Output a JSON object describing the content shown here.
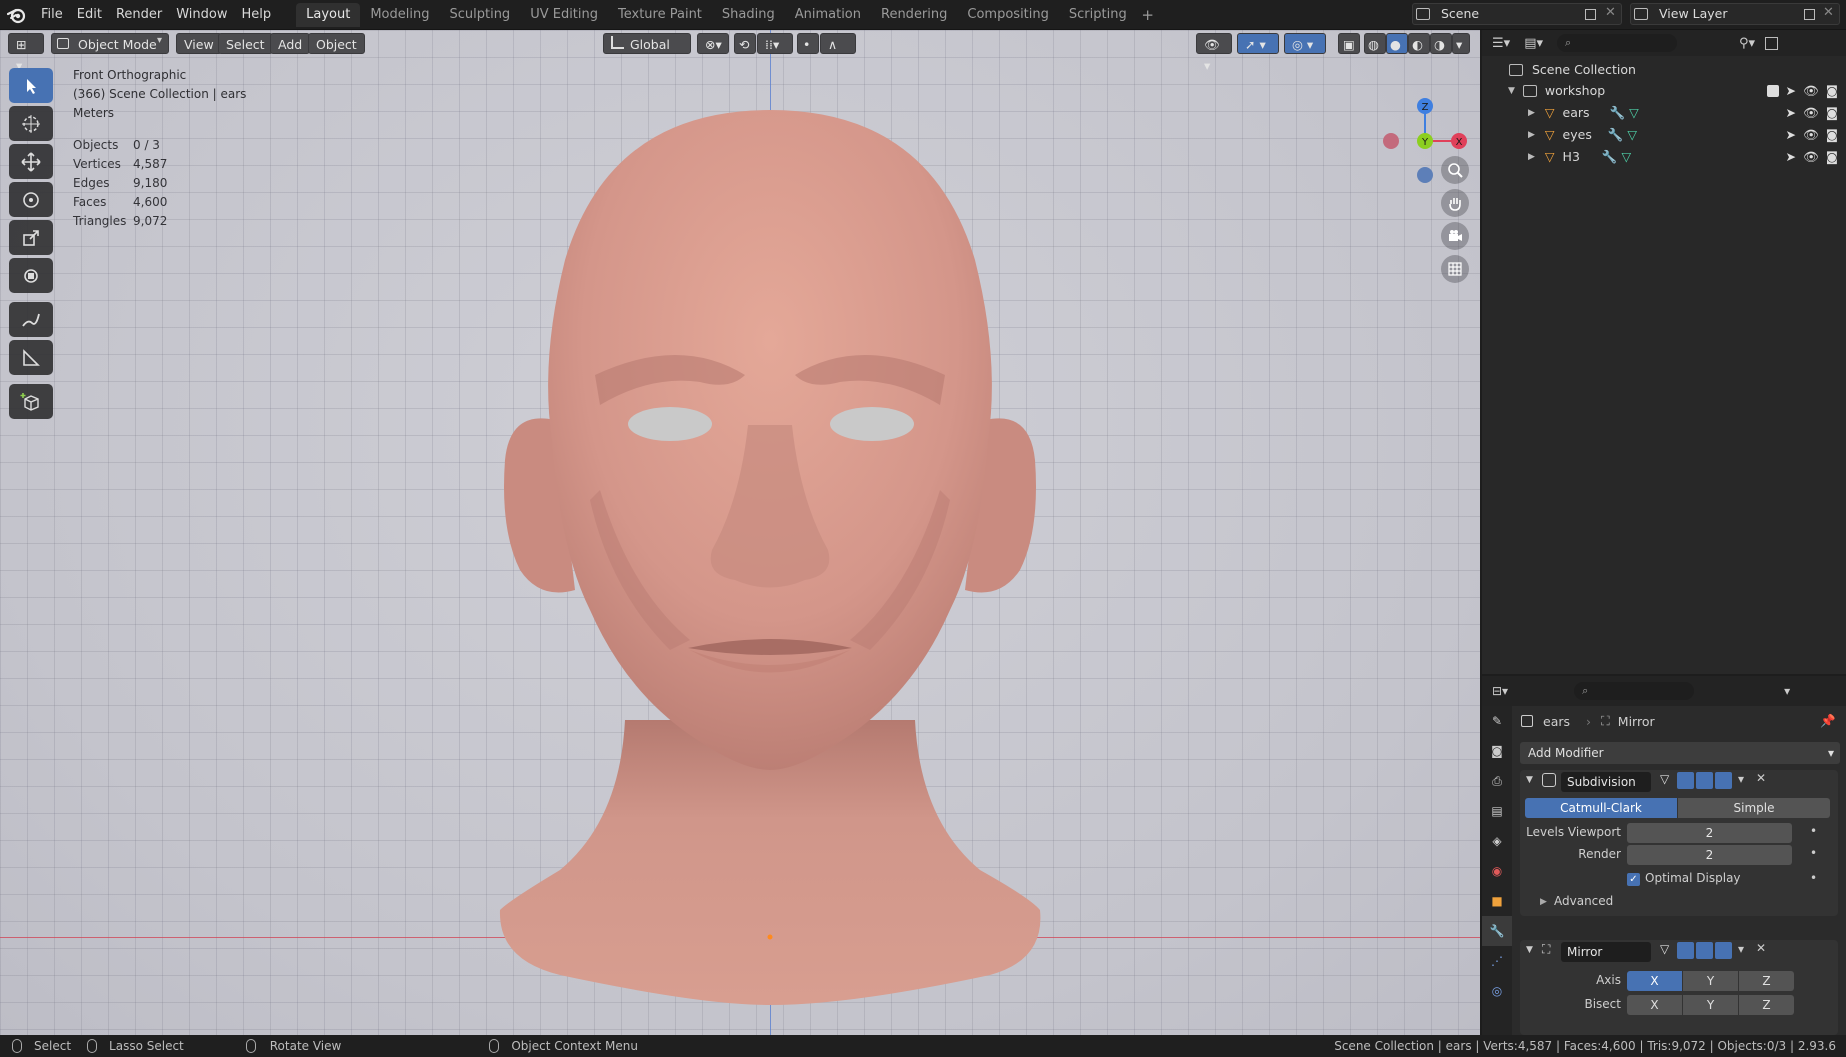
{
  "menu": [
    "File",
    "Edit",
    "Render",
    "Window",
    "Help"
  ],
  "workspaces": [
    "Layout",
    "Modeling",
    "Sculpting",
    "UV Editing",
    "Texture Paint",
    "Shading",
    "Animation",
    "Rendering",
    "Compositing",
    "Scripting"
  ],
  "active_workspace": "Layout",
  "scene_name": "Scene",
  "view_layer_name": "View Layer",
  "viewport": {
    "mode": "Object Mode",
    "menus": [
      "View",
      "Select",
      "Add",
      "Object"
    ],
    "orientation": "Global",
    "view_name": "Front Orthographic",
    "collection_info": "(366) Scene Collection | ears",
    "units": "Meters",
    "stats": [
      {
        "label": "Objects",
        "value": "0 / 3"
      },
      {
        "label": "Vertices",
        "value": "4,587"
      },
      {
        "label": "Edges",
        "value": "9,180"
      },
      {
        "label": "Faces",
        "value": "4,600"
      },
      {
        "label": "Triangles",
        "value": "9,072"
      }
    ],
    "gizmo": {
      "z": "Z",
      "y": "Y",
      "x": "X"
    }
  },
  "outliner": {
    "root": "Scene Collection",
    "collection": "workshop",
    "objects": [
      "ears",
      "eyes",
      "H3"
    ]
  },
  "properties": {
    "object": "ears",
    "modifier_crumb": "Mirror",
    "add_modifier": "Add Modifier",
    "subdivision": {
      "name": "Subdivision",
      "type_options": [
        "Catmull-Clark",
        "Simple"
      ],
      "active_type": "Catmull-Clark",
      "levels_viewport_label": "Levels Viewport",
      "levels_viewport": "2",
      "render_label": "Render",
      "render": "2",
      "optimal_display_label": "Optimal Display",
      "optimal_display": true,
      "advanced_label": "Advanced"
    },
    "mirror": {
      "name": "Mirror",
      "axis_label": "Axis",
      "axis": [
        "X",
        "Y",
        "Z"
      ],
      "bisect_label": "Bisect",
      "bisect": [
        "X",
        "Y",
        "Z"
      ]
    }
  },
  "statusbar": {
    "select": "Select",
    "lasso": "Lasso Select",
    "rotate": "Rotate View",
    "context": "Object Context Menu",
    "info": "Scene Collection | ears | Verts:4,587 | Faces:4,600 | Tris:9,072 | Objects:0/3 | 2.93.6"
  },
  "colors": {
    "accent": "#4772b3",
    "skin": "#d4988a",
    "viewport_bg": "#d0d0d6",
    "axis_x": "#e0405a",
    "axis_y": "#8ccf1f",
    "axis_z": "#3f7fe0"
  }
}
